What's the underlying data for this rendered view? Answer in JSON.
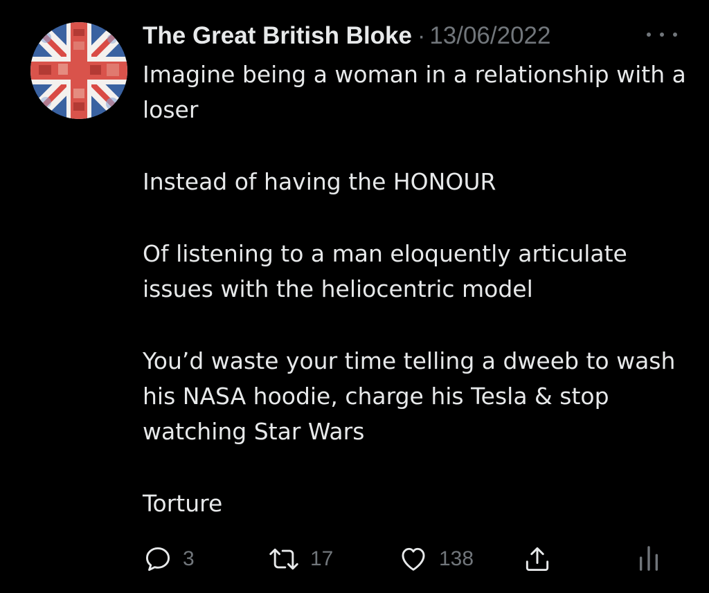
{
  "tweet": {
    "author_name": "The Great British Bloke",
    "separator": "·",
    "date": "13/06/2022",
    "paragraphs": [
      "Imagine being a woman in a relationship with a loser",
      "Instead of having the HONOUR",
      "Of listening to a man eloquently articulate issues with the heliocentric model",
      "You’d waste your time telling a dweeb to wash his NASA hoodie, charge his Tesla & stop watching Star Wars",
      "Torture"
    ]
  },
  "actions": {
    "reply_count": "3",
    "retweet_count": "17",
    "like_count": "138"
  },
  "icons": {
    "more": "more-horizontal-icon",
    "reply": "reply-icon",
    "retweet": "retweet-icon",
    "like": "heart-icon",
    "share": "share-icon",
    "analytics": "analytics-icon"
  },
  "colors": {
    "background": "#000000",
    "text": "#e7e9ea",
    "secondary": "#71767b",
    "flag_red": "#c8102e",
    "flag_blue": "#1f3c88"
  }
}
